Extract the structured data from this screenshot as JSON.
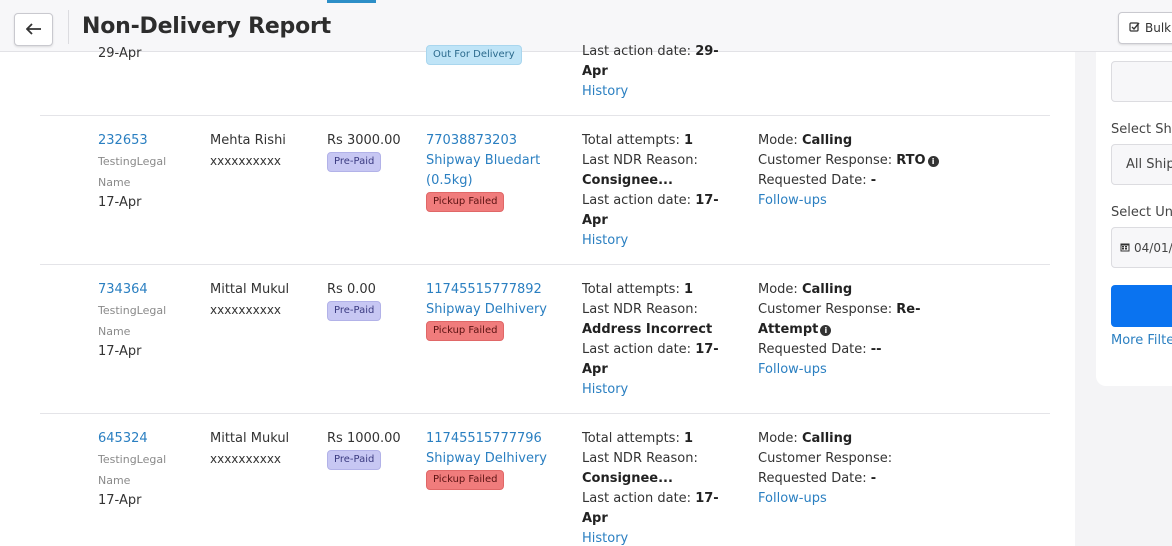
{
  "header": {
    "title": "Non-Delivery Report",
    "bulk_label": "Bulk"
  },
  "partial_row": {
    "date": "29-Apr",
    "badge": "Out For Delivery",
    "last_action_label": "Last action date:",
    "last_action_value": "29-",
    "last_action_value2": "Apr",
    "history": "History"
  },
  "rows": [
    {
      "order_id": "232653",
      "company_line1": "TestingLegal",
      "company_line2": "Name",
      "date": "17-Apr",
      "customer": "Mehta Rishi",
      "phone": "xxxxxxxxxx",
      "amount": "Rs 3000.00",
      "payment": "Pre-Paid",
      "awb": "77038873203",
      "courier_line1": "Shipway Bluedart",
      "courier_line2": "(0.5kg)",
      "status": "Pickup Failed",
      "attempts_label": "Total attempts:",
      "attempts": "1",
      "reason_label": "Last NDR Reason:",
      "reason": "Consignee...",
      "last_action_label": "Last action date:",
      "last_action_1": "17-",
      "last_action_2": "Apr",
      "history": "History",
      "mode_label": "Mode:",
      "mode": "Calling",
      "response_label": "Customer Response:",
      "response": "RTO",
      "response2": "",
      "requested_label": "Requested Date:",
      "requested": "-",
      "followups": "Follow-ups"
    },
    {
      "order_id": "734364",
      "company_line1": "TestingLegal",
      "company_line2": "Name",
      "date": "17-Apr",
      "customer": "Mittal Mukul",
      "phone": "xxxxxxxxxx",
      "amount": "Rs 0.00",
      "payment": "Pre-Paid",
      "awb": "11745515777892",
      "courier_line1": "Shipway Delhivery",
      "courier_line2": "",
      "status": "Pickup Failed",
      "attempts_label": "Total attempts:",
      "attempts": "1",
      "reason_label": "Last NDR Reason:",
      "reason": "Address Incorrect",
      "last_action_label": "Last action date:",
      "last_action_1": "17-",
      "last_action_2": "Apr",
      "history": "History",
      "mode_label": "Mode:",
      "mode": "Calling",
      "response_label": "Customer Response:",
      "response": "Re-",
      "response2": "Attempt",
      "requested_label": "Requested Date:",
      "requested": "--",
      "followups": "Follow-ups"
    },
    {
      "order_id": "645324",
      "company_line1": "TestingLegal",
      "company_line2": "Name",
      "date": "17-Apr",
      "customer": "Mittal Mukul",
      "phone": "xxxxxxxxxx",
      "amount": "Rs 1000.00",
      "payment": "Pre-Paid",
      "awb": "11745515777796",
      "courier_line1": "Shipway Delhivery",
      "courier_line2": "",
      "status": "Pickup Failed",
      "attempts_label": "Total attempts:",
      "attempts": "1",
      "reason_label": "Last NDR Reason:",
      "reason": "Consignee...",
      "last_action_label": "Last action date:",
      "last_action_1": "17-",
      "last_action_2": "Apr",
      "history": "History",
      "mode_label": "Mode:",
      "mode": "Calling",
      "response_label": "Customer Response:",
      "response": "",
      "response2": "",
      "requested_label": "Requested Date:",
      "requested": "-",
      "followups": "Follow-ups"
    }
  ],
  "sidebar": {
    "label_shipping": "Select Shi",
    "shipping_value": "All Ship",
    "label_date": "Select Und",
    "date_value": "04/01/",
    "more_filters": "More Filte"
  },
  "colors": {
    "link": "#2a7fc1",
    "primary": "#0a73f0",
    "pickup_failed": "#f07c7c",
    "prepaid": "#c7c7f3",
    "out_for_delivery": "#bfe4f7"
  }
}
